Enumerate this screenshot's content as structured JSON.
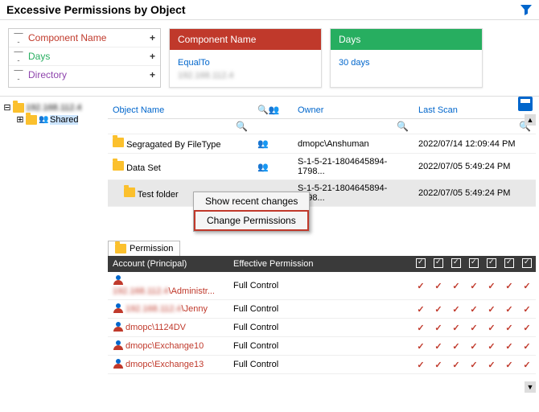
{
  "header": {
    "title": "Excessive Permissions by Object"
  },
  "filters": {
    "items": [
      {
        "label": "Component Name",
        "color": "#c0392b"
      },
      {
        "label": "Days",
        "color": "#27ae60"
      },
      {
        "label": "Directory",
        "color": "#8e44ad"
      }
    ]
  },
  "cards": {
    "component": {
      "title": "Component Name",
      "link": "EqualTo",
      "sub": "192.168.112.4"
    },
    "days": {
      "title": "Days",
      "link": "30 days"
    }
  },
  "tree": {
    "root": "192.168.112.4",
    "child": "Shared"
  },
  "objects": {
    "headers": {
      "name": "Object Name",
      "owner": "Owner",
      "scan": "Last Scan"
    },
    "rows": [
      {
        "name": "Segragated By FileType",
        "owner": "dmopc\\Anshuman",
        "scan": "2022/07/14 12:09:44 PM"
      },
      {
        "name": "Data Set",
        "owner": "S-1-5-21-1804645894-1798...",
        "scan": "2022/07/05 5:49:24 PM"
      },
      {
        "name": "Test folder",
        "owner": "S-1-5-21-1804645894-1798...",
        "scan": "2022/07/05 5:49:24 PM"
      }
    ]
  },
  "contextMenu": {
    "item1": "Show recent changes",
    "item2": "Change Permissions"
  },
  "permissions": {
    "tab": "Permission",
    "headers": {
      "account": "Account (Principal)",
      "effective": "Effective Permission"
    },
    "rows": [
      {
        "account": "\\Administr...",
        "perm": "Full Control"
      },
      {
        "account": "\\Jenny",
        "perm": "Full Control"
      },
      {
        "account": "dmopc\\1124DV",
        "perm": "Full Control"
      },
      {
        "account": "dmopc\\Exchange10",
        "perm": "Full Control"
      },
      {
        "account": "dmopc\\Exchange13",
        "perm": "Full Control"
      }
    ]
  }
}
